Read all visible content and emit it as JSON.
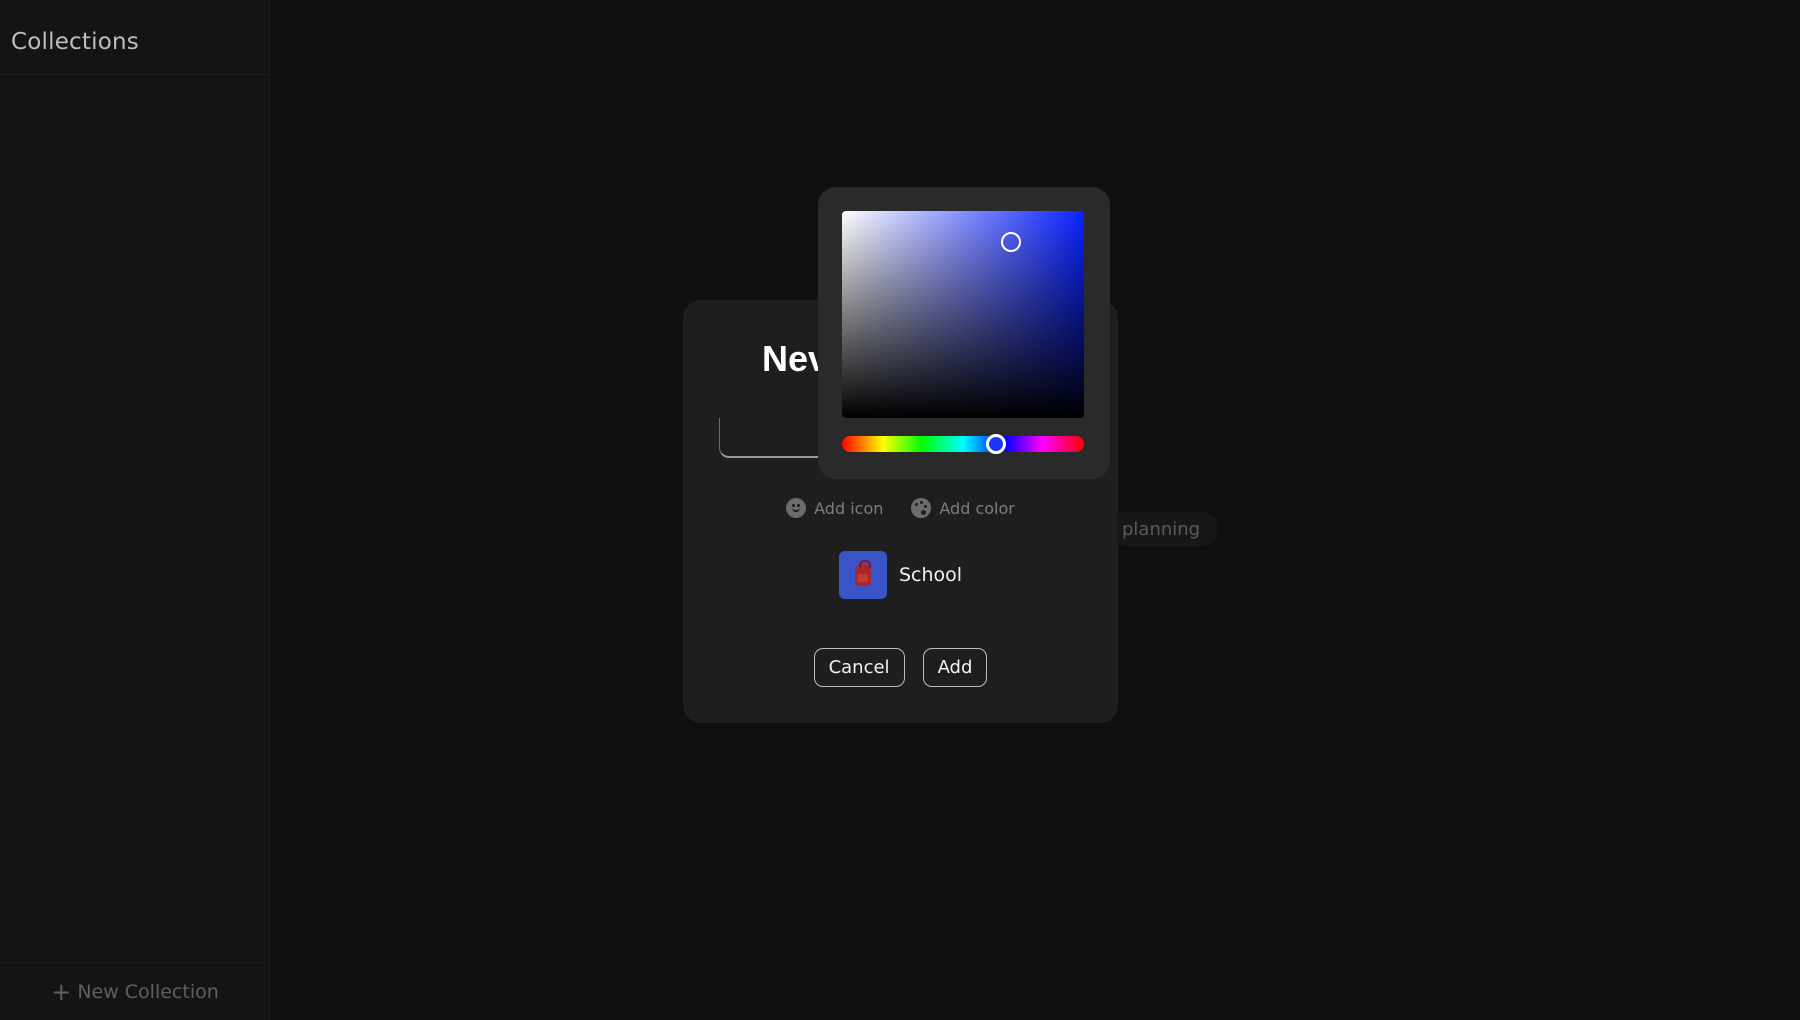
{
  "sidebar": {
    "title": "Collections",
    "new_collection_label": "New Collection"
  },
  "background": {
    "chip_label": "planning"
  },
  "dialog": {
    "title": "Nev",
    "name_input_value": "",
    "add_icon_label": "Add icon",
    "add_color_label": "Add color",
    "preview": {
      "name": "School",
      "icon": "backpack-icon",
      "color": "#3b53c9"
    },
    "cancel_label": "Cancel",
    "add_label": "Add"
  },
  "color_picker": {
    "hue_color": "#0a22ff",
    "selected_color": "#1a35ff"
  }
}
